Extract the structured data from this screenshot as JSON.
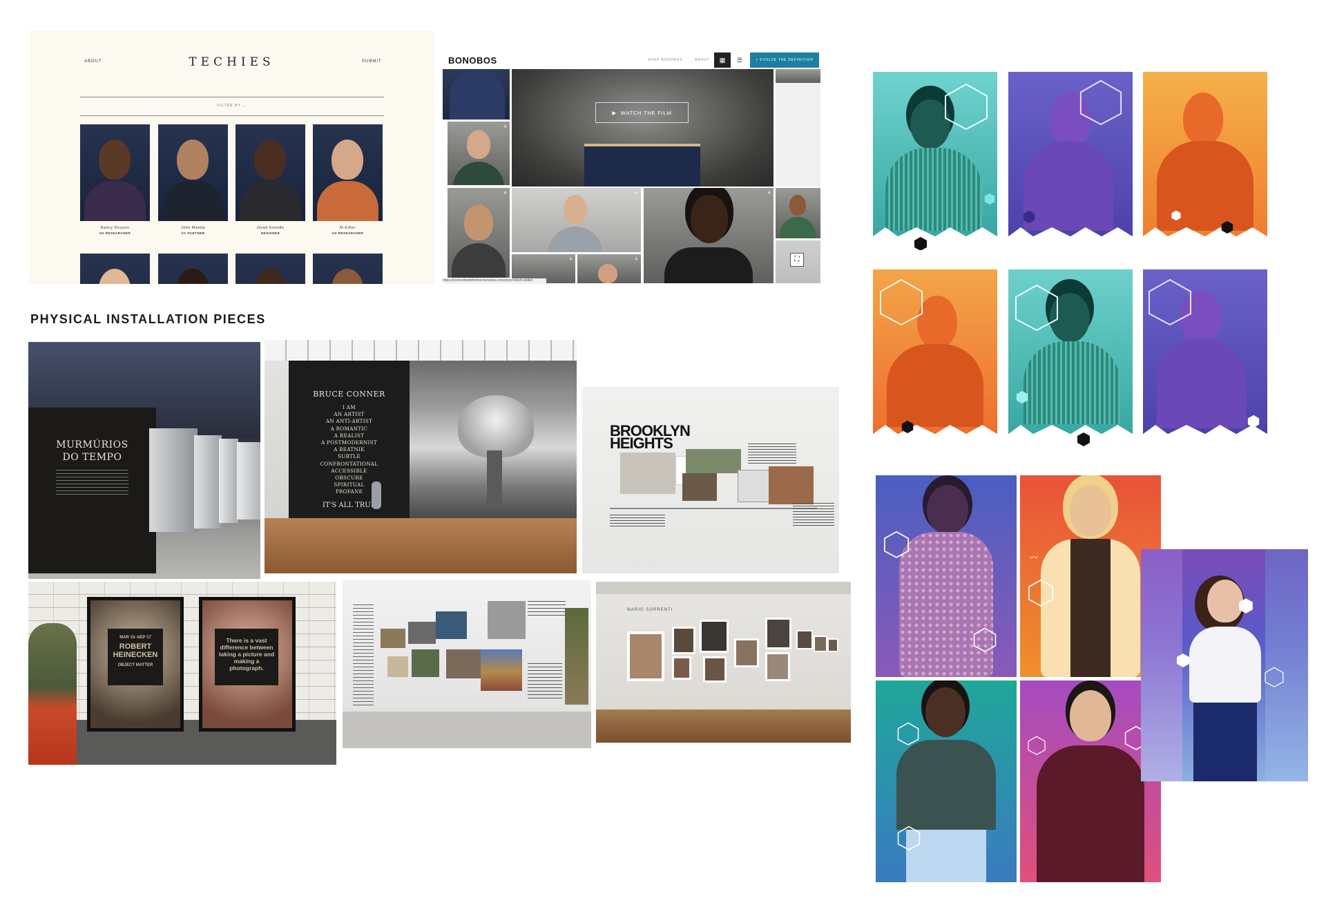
{
  "techies": {
    "nav_about": "ABOUT",
    "logo": "TECHIES",
    "nav_submit": "SUBMIT",
    "filter_label": "FILTER BY",
    "people": [
      {
        "name": "Nancy Douyon",
        "role": "UX RESEARCHER"
      },
      {
        "name": "John Maeda",
        "role": "VC PARTNER"
      },
      {
        "name": "Jerad Evendo",
        "role": "DESIGNER"
      },
      {
        "name": "M Eifler",
        "role": "UX RESEARCHER"
      }
    ]
  },
  "bonobos": {
    "brand": "BONOBOS",
    "nav_shop": "SHOP BONOBOS",
    "nav_about": "ABOUT",
    "evolve_label": "+ EVOLVE THE DEFINITION",
    "watch_label": "WATCH THE FILM",
    "url": "https://evolvethedefinition.bonobos.com/story/robert-walker"
  },
  "section_heading": "PHYSICAL INSTALLATION PIECES",
  "installations": {
    "murmurios_title_1": "MURMÚRIOS",
    "murmurios_title_2": "DO TEMPO",
    "conner_title": "BRUCE CONNER",
    "conner_lines": [
      "I AM",
      "AN ARTIST",
      "AN ANTI-ARTIST",
      "A ROMANTIC",
      "A REALIST",
      "A POSTMODERNIST",
      "A BEATNIK",
      "SUBTLE",
      "CONFRONTATIONAL",
      "ACCESSIBLE",
      "OBSCURE",
      "SPIRITUAL",
      "PROFANE"
    ],
    "conner_tag": "IT'S ALL TRUE",
    "brooklyn_title_1": "BROOKLYN",
    "brooklyn_title_2": "HEIGHTS",
    "poster1_dates": "MAR 15–SEP 17",
    "poster1_name_1": "ROBERT",
    "poster1_name_2": "HEINECKEN",
    "poster1_sub": "OBJECT MATTER",
    "poster2_quote": "There is a vast difference between taking a picture and making a photograph.",
    "gallery_title": "MARIO SORRENTI"
  },
  "colors": {
    "teal": "#5cc7c1",
    "purple": "#5a4fb5",
    "orange": "#f0883a",
    "navy": "#1f2a44",
    "bonobos_blue": "#1c7fa0"
  }
}
